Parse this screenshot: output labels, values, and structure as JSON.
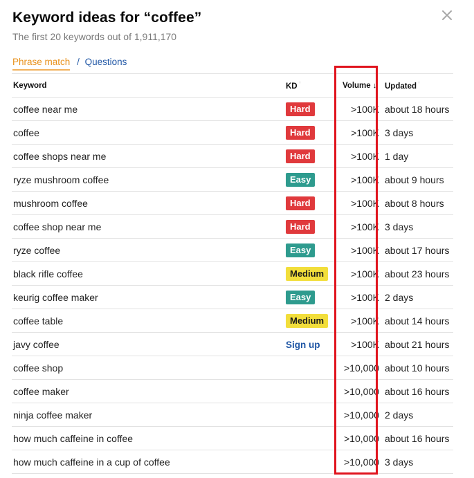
{
  "header": {
    "title": "Keyword ideas for “coffee”",
    "subtitle": "The first 20 keywords out of 1,911,170"
  },
  "tabs": {
    "active": "Phrase match",
    "separator": "/",
    "other": "Questions"
  },
  "columns": {
    "keyword": "Keyword",
    "kd": "KD",
    "volume": "Volume",
    "updated": "Updated"
  },
  "icons": {
    "close": "close-icon",
    "info": "info-icon",
    "sort": "sort-down-arrow-icon"
  },
  "colors": {
    "hard": "#e0393c",
    "easy": "#2e9b8e",
    "medium": "#f2de3b",
    "active_tab": "#e8911b",
    "link": "#1f56a5",
    "highlight": "#e0141e"
  },
  "rows": [
    {
      "keyword": "coffee near me",
      "kd": "Hard",
      "kd_type": "hard",
      "volume": ">100K",
      "updated": "about 18 hours"
    },
    {
      "keyword": "coffee",
      "kd": "Hard",
      "kd_type": "hard",
      "volume": ">100K",
      "updated": "3 days"
    },
    {
      "keyword": "coffee shops near me",
      "kd": "Hard",
      "kd_type": "hard",
      "volume": ">100K",
      "updated": "1 day"
    },
    {
      "keyword": "ryze mushroom coffee",
      "kd": "Easy",
      "kd_type": "easy",
      "volume": ">100K",
      "updated": "about 9 hours"
    },
    {
      "keyword": "mushroom coffee",
      "kd": "Hard",
      "kd_type": "hard",
      "volume": ">100K",
      "updated": "about 8 hours"
    },
    {
      "keyword": "coffee shop near me",
      "kd": "Hard",
      "kd_type": "hard",
      "volume": ">100K",
      "updated": "3 days"
    },
    {
      "keyword": "ryze coffee",
      "kd": "Easy",
      "kd_type": "easy",
      "volume": ">100K",
      "updated": "about 17 hours"
    },
    {
      "keyword": "black rifle coffee",
      "kd": "Medium",
      "kd_type": "medium",
      "volume": ">100K",
      "updated": "about 23 hours"
    },
    {
      "keyword": "keurig coffee maker",
      "kd": "Easy",
      "kd_type": "easy",
      "volume": ">100K",
      "updated": "2 days"
    },
    {
      "keyword": "coffee table",
      "kd": "Medium",
      "kd_type": "medium",
      "volume": ">100K",
      "updated": "about 14 hours"
    },
    {
      "keyword": "javy coffee",
      "kd": "Sign up",
      "kd_type": "signup",
      "volume": ">100K",
      "updated": "about 21 hours"
    },
    {
      "keyword": "coffee shop",
      "kd": "",
      "kd_type": "none",
      "volume": ">10,000",
      "updated": "about 10 hours"
    },
    {
      "keyword": "coffee maker",
      "kd": "",
      "kd_type": "none",
      "volume": ">10,000",
      "updated": "about 16 hours"
    },
    {
      "keyword": "ninja coffee maker",
      "kd": "",
      "kd_type": "none",
      "volume": ">10,000",
      "updated": "2 days"
    },
    {
      "keyword": "how much caffeine in coffee",
      "kd": "",
      "kd_type": "none",
      "volume": ">10,000",
      "updated": "about 16 hours"
    },
    {
      "keyword": "how much caffeine in a cup of coffee",
      "kd": "",
      "kd_type": "none",
      "volume": ">10,000",
      "updated": "3 days"
    }
  ]
}
